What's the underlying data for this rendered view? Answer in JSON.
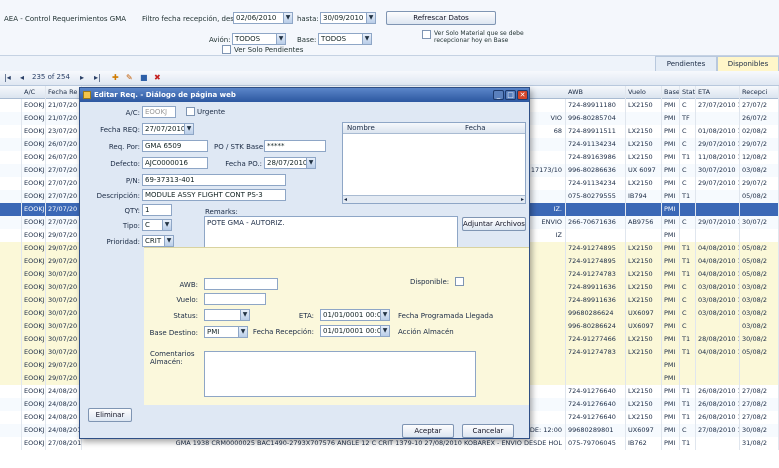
{
  "header": {
    "title": "AEA - Control Requerimientos GMA",
    "filter_label": "Filtro fecha recepción, desde:",
    "date_from": "02/06/2010",
    "hasta_label": "hasta:",
    "date_to": "30/09/2010",
    "refresh_label": "Refrescar Datos",
    "avion_label": "Avión:",
    "avion_value": "TODOS",
    "base_label": "Base:",
    "base_value": "TODOS",
    "check_material_label": "Ver Solo Material que se debe recepcionar hoy en Base",
    "check_pendientes_label": "Ver Solo Pendientes"
  },
  "tabs": [
    "Pendientes",
    "Disponibles"
  ],
  "navigator": {
    "position": "235 of 254"
  },
  "grid": {
    "columns": [
      "A/C",
      "Fecha Re",
      "AWB",
      "Vuelo",
      "Base",
      "Stat.",
      "ETA",
      "Recepci"
    ],
    "rows": [
      {
        "ac": "EOOKJ",
        "fecha": "21/07/20",
        "mid": "",
        "awb": "724-89911180",
        "vuelo": "LX2150",
        "base": "PMI",
        "stat": "C",
        "eta": "27/07/2010 1:",
        "rec": "27/07/2"
      },
      {
        "ac": "EOOKJ",
        "fecha": "21/07/20",
        "mid": "VIO",
        "awb": "996-80285704",
        "vuelo": "",
        "base": "PMI",
        "stat": "TF",
        "eta": "",
        "rec": "26/07/2"
      },
      {
        "ac": "EOOKJ",
        "fecha": "23/07/20",
        "mid": "68",
        "awb": "724-89911511",
        "vuelo": "LX2150",
        "base": "PMI",
        "stat": "C",
        "eta": "01/08/2010 1:",
        "rec": "02/08/2"
      },
      {
        "ac": "EOOKJ",
        "fecha": "26/07/20",
        "mid": "",
        "awb": "724-91134234",
        "vuelo": "LX2150",
        "base": "PMI",
        "stat": "C",
        "eta": "29/07/2010 1:",
        "rec": "29/07/2"
      },
      {
        "ac": "EOOKJ",
        "fecha": "26/07/20",
        "mid": "",
        "awb": "724-89163986",
        "vuelo": "LX2150",
        "base": "PMI",
        "stat": "T1",
        "eta": "11/08/2010 1:",
        "rec": "12/08/2"
      },
      {
        "ac": "EOOKJ",
        "fecha": "27/07/20",
        "mid": "17173/10",
        "awb": "996-80286636",
        "vuelo": "UX 6097",
        "base": "PMI",
        "stat": "C",
        "eta": "30/07/2010",
        "rec": "03/08/2"
      },
      {
        "ac": "EOOKJ",
        "fecha": "27/07/20",
        "mid": "",
        "awb": "724-91134234",
        "vuelo": "LX2150",
        "base": "PMI",
        "stat": "C",
        "eta": "29/07/2010 1:",
        "rec": "29/07/2"
      },
      {
        "ac": "EOOKJ",
        "fecha": "27/07/20",
        "mid": "",
        "awb": "075-80279555",
        "vuelo": "IB794",
        "base": "PMI",
        "stat": "T1",
        "eta": "",
        "rec": "05/08/2"
      },
      {
        "ac": "EOOKJ",
        "fecha": "27/07/20",
        "mid": "IZ.",
        "awb": "",
        "vuelo": "",
        "base": "PMI",
        "stat": "",
        "eta": "",
        "rec": ""
      },
      {
        "ac": "EOOKJ",
        "fecha": "27/07/20",
        "mid": "ENVIO",
        "awb": "266-70671636",
        "vuelo": "AB9756",
        "base": "PMI",
        "stat": "C",
        "eta": "29/07/2010 1:",
        "rec": "30/07/2"
      },
      {
        "ac": "EOOKJ",
        "fecha": "29/07/20",
        "mid": "IZ",
        "awb": "",
        "vuelo": "",
        "base": "PMI",
        "stat": "",
        "eta": "",
        "rec": ""
      },
      {
        "ac": "EOOKJ",
        "fecha": "29/07/20",
        "mid": "",
        "awb": "724-91274895",
        "vuelo": "LX2150",
        "base": "PMI",
        "stat": "T1",
        "eta": "04/08/2010 1:",
        "rec": "05/08/2"
      },
      {
        "ac": "EOOKJ",
        "fecha": "29/07/20",
        "mid": "",
        "awb": "724-91274895",
        "vuelo": "LX2150",
        "base": "PMI",
        "stat": "T1",
        "eta": "04/08/2010 1:",
        "rec": "05/08/2"
      },
      {
        "ac": "EOOKJ",
        "fecha": "30/07/20",
        "mid": "",
        "awb": "724-91274783",
        "vuelo": "LX2150",
        "base": "PMI",
        "stat": "T1",
        "eta": "04/08/2010 1:",
        "rec": "05/08/2"
      },
      {
        "ac": "EOOKJ",
        "fecha": "30/07/20",
        "mid": "",
        "awb": "724-89911636",
        "vuelo": "LX2150",
        "base": "PMI",
        "stat": "C",
        "eta": "03/08/2010 1:",
        "rec": "03/08/2"
      },
      {
        "ac": "EOOKJ",
        "fecha": "30/07/20",
        "mid": "",
        "awb": "724-89911636",
        "vuelo": "LX2150",
        "base": "PMI",
        "stat": "C",
        "eta": "03/08/2010 1:",
        "rec": "03/08/2"
      },
      {
        "ac": "EOOKJ",
        "fecha": "30/07/20",
        "mid": "",
        "awb": "99680286624",
        "vuelo": "UX6097",
        "base": "PMI",
        "stat": "C",
        "eta": "03/08/2010 1:",
        "rec": "03/08/2"
      },
      {
        "ac": "EOOKJ",
        "fecha": "30/07/20",
        "mid": "",
        "awb": "996-80286624",
        "vuelo": "UX6097",
        "base": "PMI",
        "stat": "C",
        "eta": "",
        "rec": "03/08/2"
      },
      {
        "ac": "EOOKJ",
        "fecha": "30/07/20",
        "mid": "",
        "awb": "724-91277466",
        "vuelo": "LX2150",
        "base": "PMI",
        "stat": "T1",
        "eta": "28/08/2010 1:",
        "rec": "30/08/2"
      },
      {
        "ac": "EOOKJ",
        "fecha": "30/07/20",
        "mid": "",
        "awb": "724-91274783",
        "vuelo": "LX2150",
        "base": "PMI",
        "stat": "T1",
        "eta": "04/08/2010 1:",
        "rec": "05/08/2"
      },
      {
        "ac": "EOOKJ",
        "fecha": "29/07/20",
        "mid": "",
        "awb": "",
        "vuelo": "",
        "base": "PMI",
        "stat": "",
        "eta": "",
        "rec": ""
      },
      {
        "ac": "EOOKJ",
        "fecha": "29/07/20",
        "mid": "",
        "awb": "",
        "vuelo": "",
        "base": "PMI",
        "stat": "",
        "eta": "",
        "rec": ""
      },
      {
        "ac": "EOOKJ",
        "fecha": "24/08/20",
        "mid": "",
        "awb": "724-91276640",
        "vuelo": "LX2150",
        "base": "PMI",
        "stat": "T1",
        "eta": "26/08/2010 1:",
        "rec": "27/08/2"
      },
      {
        "ac": "EOOKJ",
        "fecha": "24/08/20",
        "mid": "",
        "awb": "724-91276640",
        "vuelo": "LX2150",
        "base": "PMI",
        "stat": "T1",
        "eta": "26/08/2010 1:",
        "rec": "27/08/2"
      },
      {
        "ac": "EOOKJ",
        "fecha": "24/08/20",
        "mid": "",
        "awb": "724-91276640",
        "vuelo": "LX2150",
        "base": "PMI",
        "stat": "T1",
        "eta": "26/08/2010 1:",
        "rec": "27/08/2"
      },
      {
        "ac": "EOOKJ",
        "fecha": "24/08/2010",
        "mid": "GMA 1938   CRM0000025   ...   ANGLE   1   C   CRIT   1362...   24/08/2010   SKOBAREX-PMI-ENVIO DESDE: 12:00",
        "awb": "99680289801",
        "vuelo": "UX6097",
        "base": "PMI",
        "stat": "C",
        "eta": "27/08/2010 1:",
        "rec": "30/08/2"
      },
      {
        "ac": "EOOKJ",
        "fecha": "27/08/2010",
        "mid": "GMA 1938   CRM0000025   BAC1490-2793X707576   ANGLE   12   C   CRIT   1379-10   27/08/2010   KOBAREX - ENVIO DESDE HOL",
        "awb": "075-79706045",
        "vuelo": "IB762",
        "base": "PMI",
        "stat": "T1",
        "eta": "",
        "rec": "31/08/2"
      }
    ]
  },
  "dialog": {
    "title": "Editar Req. - Diálogo de página web",
    "avc_label": "A/C:",
    "avc_value": "EOOKJ",
    "urgente_label": "Urgente",
    "fecha_req_label": "Fecha REQ:",
    "fecha_req_value": "27/07/2010",
    "req_por_label": "Req. Por:",
    "req_por_value": "GMA 6509",
    "po_label": "PO / STK Base:",
    "po_value": "*****",
    "defecto_label": "Defecto:",
    "defecto_value": "AJC0000016",
    "fecha_po_label": "Fecha PO.:",
    "fecha_po_value": "28/07/2010",
    "pn_label": "P/N:",
    "pn_value": "69-37313-401",
    "descripcion_label": "Descripción:",
    "descripcion_value": "MODULE ASSY FLIGHT CONT PS-3",
    "qty_label": "QTY:",
    "qty_value": "1",
    "tipo_label": "Tipo:",
    "tipo_value": "C",
    "prioridad_label": "Prioridad:",
    "prioridad_value": "CRIT",
    "remarks_label": "Remarks:",
    "remarks_value": "POTE GMA - AUTORIZ.",
    "attach_columns": [
      "Nombre",
      "Fecha"
    ],
    "adjuntar_label": "Adjuntar Archivos",
    "awb_label": "AWB:",
    "vuelo_label": "Vuelo:",
    "status_label": "Status:",
    "base_destino_label": "Base Destino:",
    "base_destino_value": "PMI",
    "disponible_label": "Disponible:",
    "eta_label": "ETA:",
    "eta_value": "01/01/0001 00:00",
    "eta_note": "Fecha Programada Llegada",
    "fecha_recepcion_label": "Fecha Recepción:",
    "fecha_recepcion_value": "01/01/0001 00:00",
    "fecha_recepcion_note": "Acción Almacén",
    "comentarios_label": "Comentarios Almacén:",
    "eliminar_label": "Eliminar",
    "aceptar_label": "Aceptar",
    "cancelar_label": "Cancelar"
  }
}
